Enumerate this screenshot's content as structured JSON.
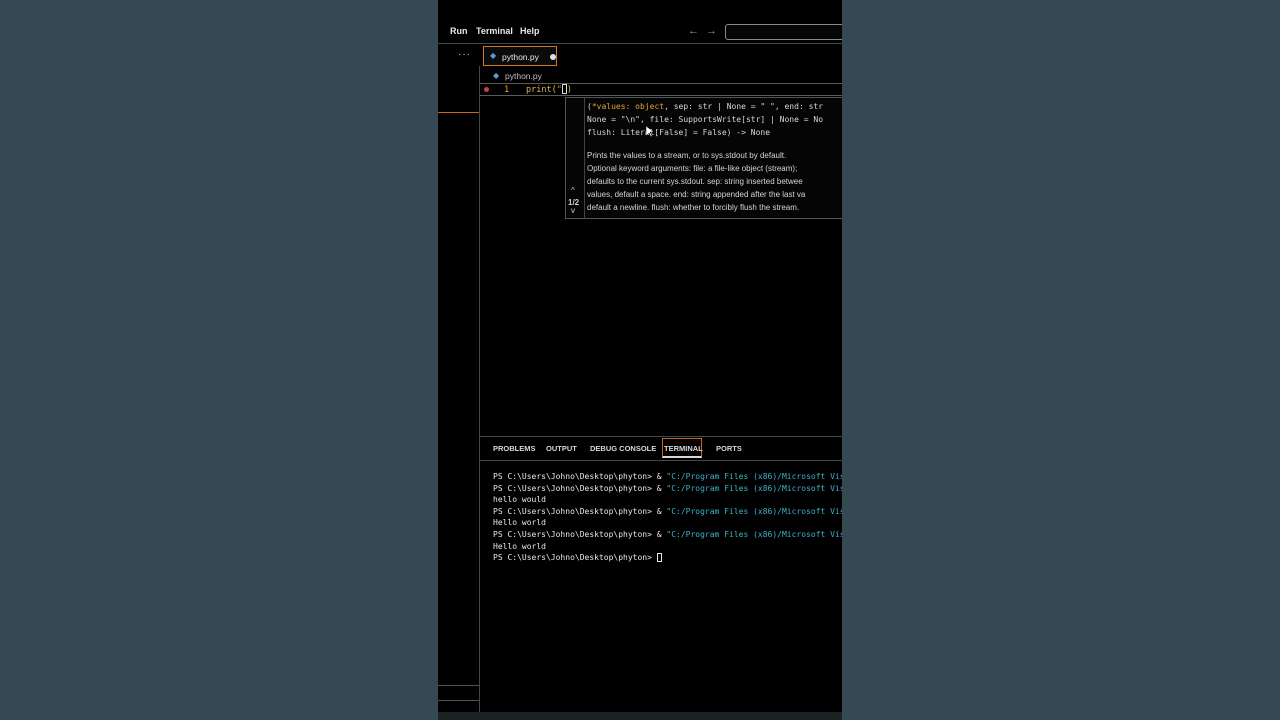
{
  "menu": {
    "run": "Run",
    "terminal": "Terminal",
    "help": "Help",
    "back": "←",
    "forward": "→"
  },
  "tab": {
    "label": "python.py",
    "dirty_dot": "●",
    "sidebar_more": "···"
  },
  "breadcrumb": {
    "label": "python.py"
  },
  "editor": {
    "line_number": "1",
    "code_fn": "print",
    "code_open": "(",
    "code_quote": "\"",
    "code_close": ")"
  },
  "hover": {
    "sig1_a": "(",
    "sig1_kw": "*values: object",
    "sig1_b": ", sep: str | None = \" \", end: str",
    "sig2": "None = \"\\n\", file: SupportsWrite[str] | None = No",
    "sig3": "flush: Literal[False] = False) -> None",
    "doc1": "Prints the values to a stream, or to sys.stdout by default.",
    "doc2": "Optional keyword arguments: file: a file-like object (stream);",
    "doc3": "defaults to the current sys.stdout. sep: string inserted betwee",
    "doc4": "values, default a space. end: string appended after the last va",
    "doc5": "default a newline. flush: whether to forcibly flush the stream.",
    "overload_up": "^",
    "overload_count": "1/2",
    "overload_down": "v"
  },
  "panel": {
    "tabs": [
      "PROBLEMS",
      "OUTPUT",
      "DEBUG CONSOLE",
      "TERMINAL",
      "PORTS"
    ],
    "active_tab": "TERMINAL"
  },
  "terminal": {
    "prompt": "PS C:\\Users\\Johno\\Desktop\\phyton> & ",
    "cmd_str": "\"C:/Program Files (x86)/Microsoft Vis",
    "out1": "hello would",
    "out2": "Hello world",
    "out3": "Hello world",
    "final_prompt": "PS C:\\Users\\Johno\\Desktop\\phyton> "
  },
  "colors": {
    "background": "#344951",
    "accent_orange": "#c9661c",
    "keyword": "#e3a33a",
    "terminal_string": "#3bb3c8"
  }
}
